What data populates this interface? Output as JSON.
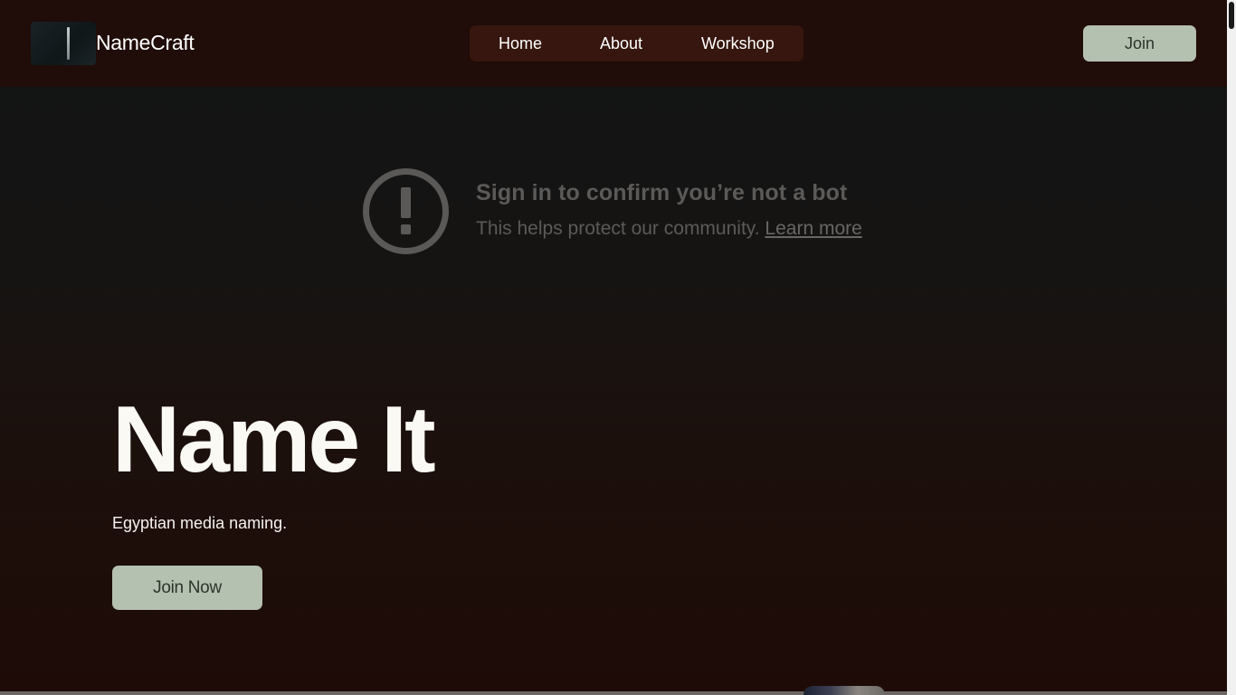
{
  "header": {
    "brand": "NameCraft",
    "nav": [
      {
        "label": "Home"
      },
      {
        "label": "About"
      },
      {
        "label": "Workshop"
      }
    ],
    "join_label": "Join"
  },
  "video_notice": {
    "title": "Sign in to confirm you’re not a bot",
    "subtitle": "This helps protect our community.",
    "link": "Learn more",
    "icon": "alert-circle-icon"
  },
  "hero": {
    "title": "Name It",
    "subtitle": "Egyptian media naming.",
    "cta": "Join Now"
  },
  "colors": {
    "background": "#1e0b07",
    "nav_pill": "#36160e",
    "button": "#b4c0b0",
    "button_text": "#2c342a"
  }
}
